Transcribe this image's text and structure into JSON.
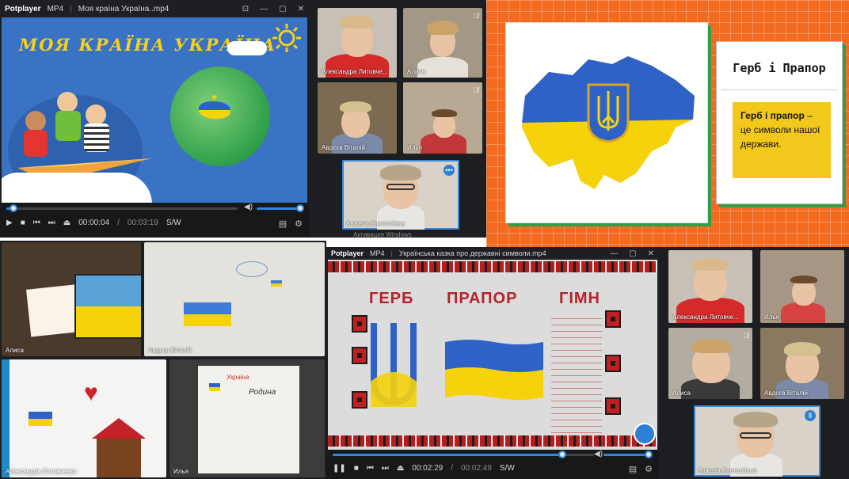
{
  "player_top": {
    "brand": "Potplayer",
    "format": "MP4",
    "filename": "Моя країна Україна..mp4",
    "slide_title": "МОЯ КРАЇНА УКРАЇНА",
    "time_current": "00:00:04",
    "time_total": "00:03:19",
    "sw": "S/W",
    "progress": 0.03
  },
  "player_bottom": {
    "brand": "Potplayer",
    "format": "MP4",
    "filename": "Українська казка про державні символи.mp4",
    "words": {
      "gerb": "ГЕРБ",
      "prapor": "ПРАПОР",
      "gimn": "ГІМН"
    },
    "time_current": "00:02:29",
    "time_total": "00:02:49",
    "sw": "S/W",
    "progress": 0.88
  },
  "call_top": {
    "tiles": [
      {
        "name": "Александра Литовче..."
      },
      {
        "name": "Алиса"
      },
      {
        "name": "Авдєєв Віталій"
      },
      {
        "name": "Илья"
      },
      {
        "name": "Анжела Анатоліївна"
      }
    ],
    "watermark": "Активация Windows"
  },
  "slide_right": {
    "heading": "Герб і Прапор",
    "text_bold": "Герб і прапор",
    "text_rest": " – це символи нашої держави."
  },
  "drawings": [
    {
      "name": "Алиса"
    },
    {
      "name": "Авдєєв Віталій"
    },
    {
      "name": "Александра Литовченко"
    },
    {
      "name": "Илья"
    }
  ],
  "drawing_text": {
    "line1": "Україна",
    "line2": "Родина"
  },
  "call_bottom": {
    "tiles": [
      {
        "name": "Александра Литовче..."
      },
      {
        "name": "Илья"
      },
      {
        "name": "Алиса"
      },
      {
        "name": "Авдєєв Віталій"
      },
      {
        "name": "Анжела Анатоліївна"
      }
    ]
  },
  "colors": {
    "ua_blue": "#2f62c6",
    "ua_yellow": "#f5d20c",
    "accent": "#2f86e0",
    "orange": "#f26b21"
  }
}
